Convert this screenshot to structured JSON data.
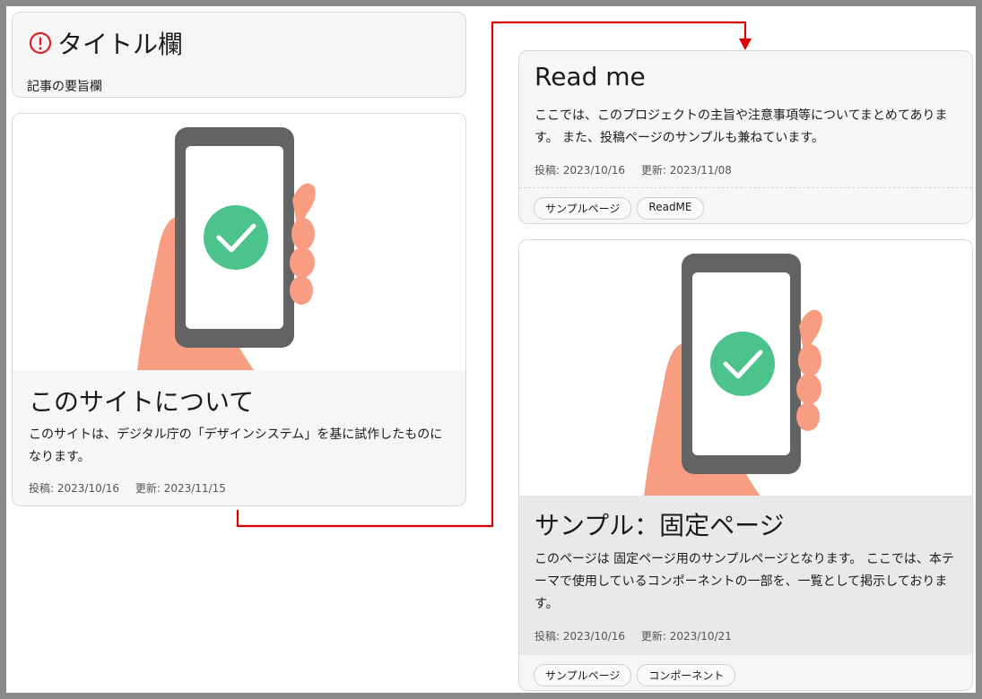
{
  "title_card": {
    "title": "タイトル欄",
    "summary": "記事の要旨欄",
    "icon": "exclamation-circle-icon"
  },
  "about_card": {
    "title": "このサイトについて",
    "text": "このサイトは、デジタル庁の「デザインシステム」を基に試作したものになります。",
    "posted": "投稿: 2023/10/16",
    "updated": "更新: 2023/11/15"
  },
  "readme_card": {
    "title": "Read me",
    "text": "ここでは、このプロジェクトの主旨や注意事項等についてまとめてあります。 また、投稿ページのサンプルも兼ねています。",
    "posted": "投稿: 2023/10/16",
    "updated": "更新: 2023/11/08",
    "tags": [
      "サンプルページ",
      "ReadME"
    ]
  },
  "sample_card": {
    "title": "サンプル：固定ページ",
    "text": "このページは 固定ページ用のサンプルページとなります。 ここでは、本テーマで使用しているコンポーネントの一部を、一覧として掲示しております。",
    "posted": "投稿: 2023/10/16",
    "updated": "更新: 2023/10/21",
    "tags": [
      "サンプルページ",
      "コンポーネント"
    ]
  },
  "colors": {
    "alert": "#e02020",
    "connector": "#dd0000",
    "phone": "#636363",
    "screen": "#ffffff",
    "check": "#4cc38a",
    "hand": "#f99d82"
  }
}
